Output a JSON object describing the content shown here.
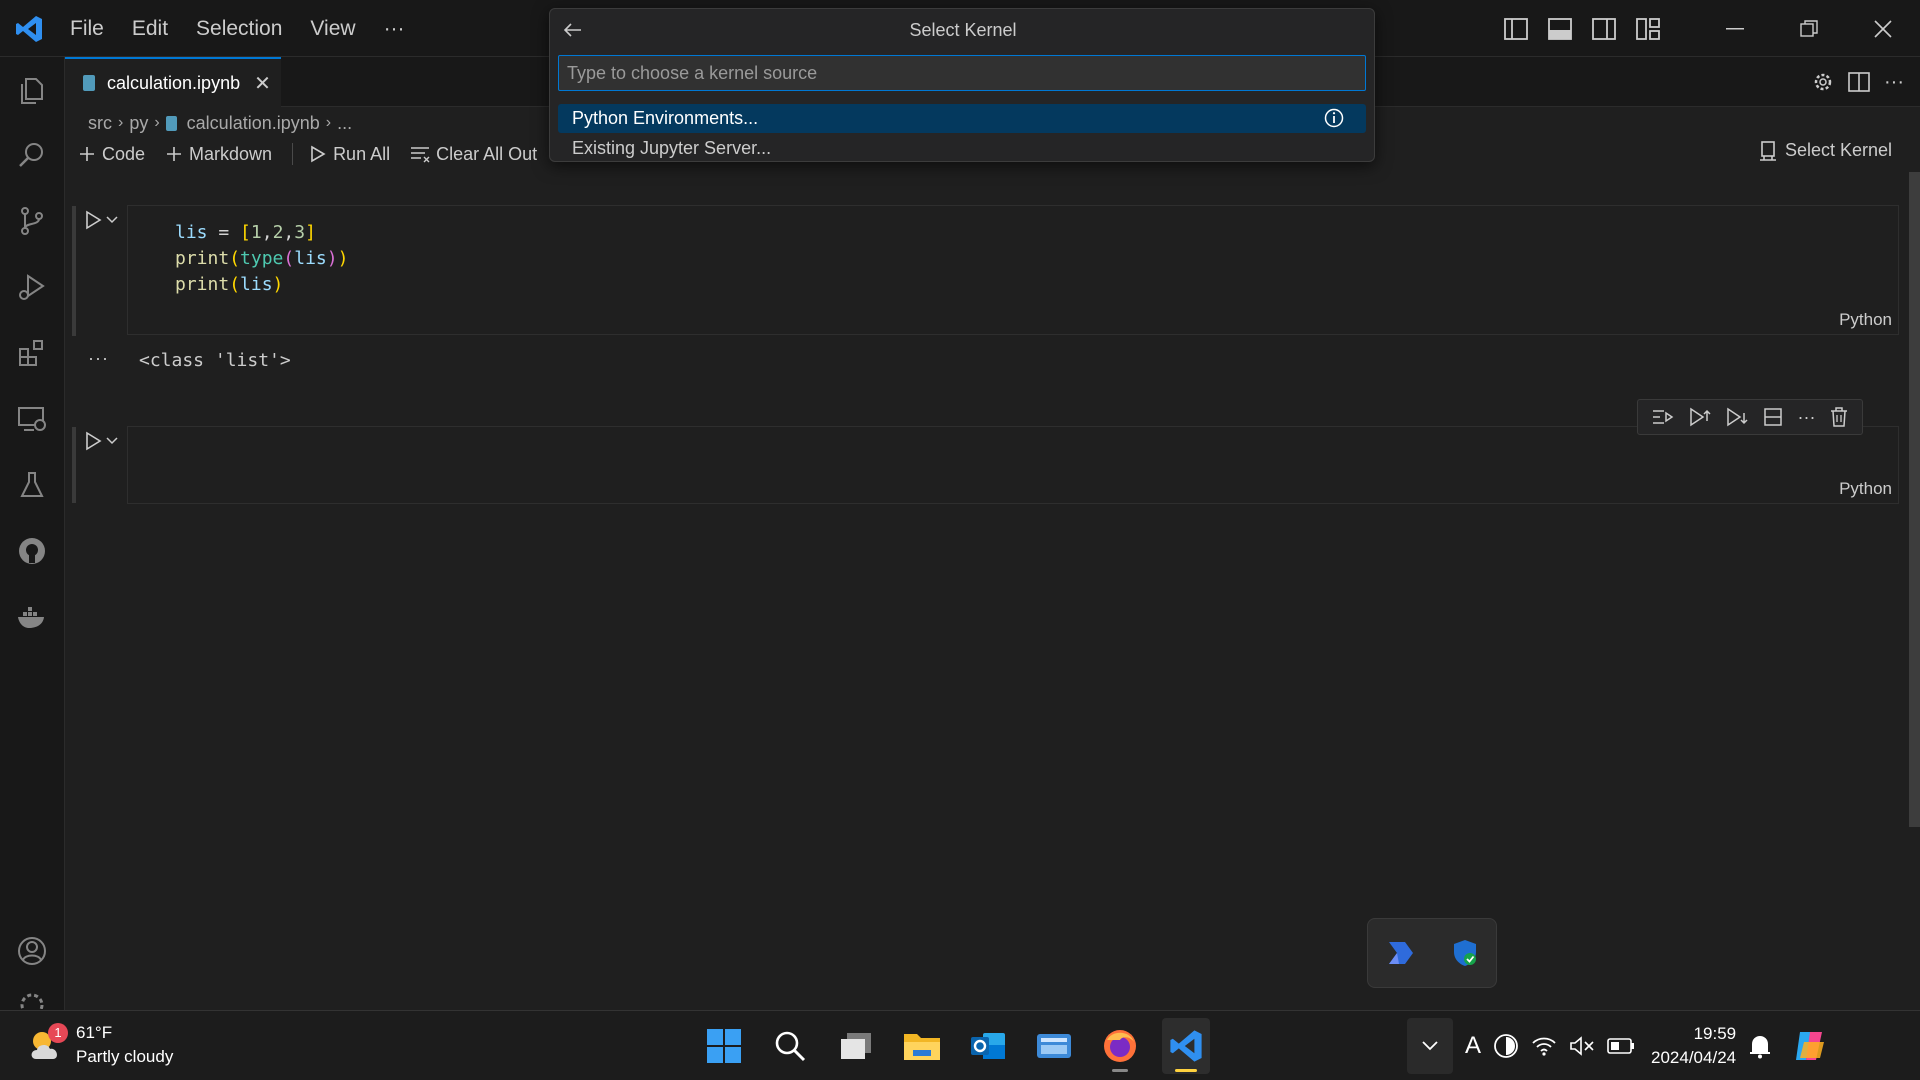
{
  "titlebar": {
    "menu": [
      "File",
      "Edit",
      "Selection",
      "View",
      "···"
    ]
  },
  "tab": {
    "label": "calculation.ipynb",
    "close": "✕"
  },
  "breadcrumb": {
    "parts": [
      "src",
      "py",
      "calculation.ipynb",
      "..."
    ]
  },
  "notebook_toolbar": {
    "code": "Code",
    "markdown": "Markdown",
    "run_all": "Run All",
    "clear_all_outputs": "Clear All Out",
    "select_kernel": "Select Kernel"
  },
  "cells": [
    {
      "code_lines": [
        "lis = [1,2,3]",
        "print(type(lis))",
        "print(lis)"
      ],
      "language": "Python",
      "output": "<class 'list'>",
      "output_more": "···"
    },
    {
      "code_lines": [],
      "language": "Python"
    }
  ],
  "quickpick": {
    "title": "Select Kernel",
    "placeholder": "Type to choose a kernel source",
    "items": [
      "Python Environments...",
      "Existing Jupyter Server..."
    ]
  },
  "taskbar": {
    "weather_temp": "61°F",
    "weather_desc": "Partly cloudy",
    "weather_badge": "1",
    "clock_time": "19:59",
    "clock_date": "2024/04/24",
    "ime": "A"
  },
  "colors": {
    "accent": "#0078d4",
    "selection": "#04395e",
    "editor_bg": "#1f1f1f"
  }
}
